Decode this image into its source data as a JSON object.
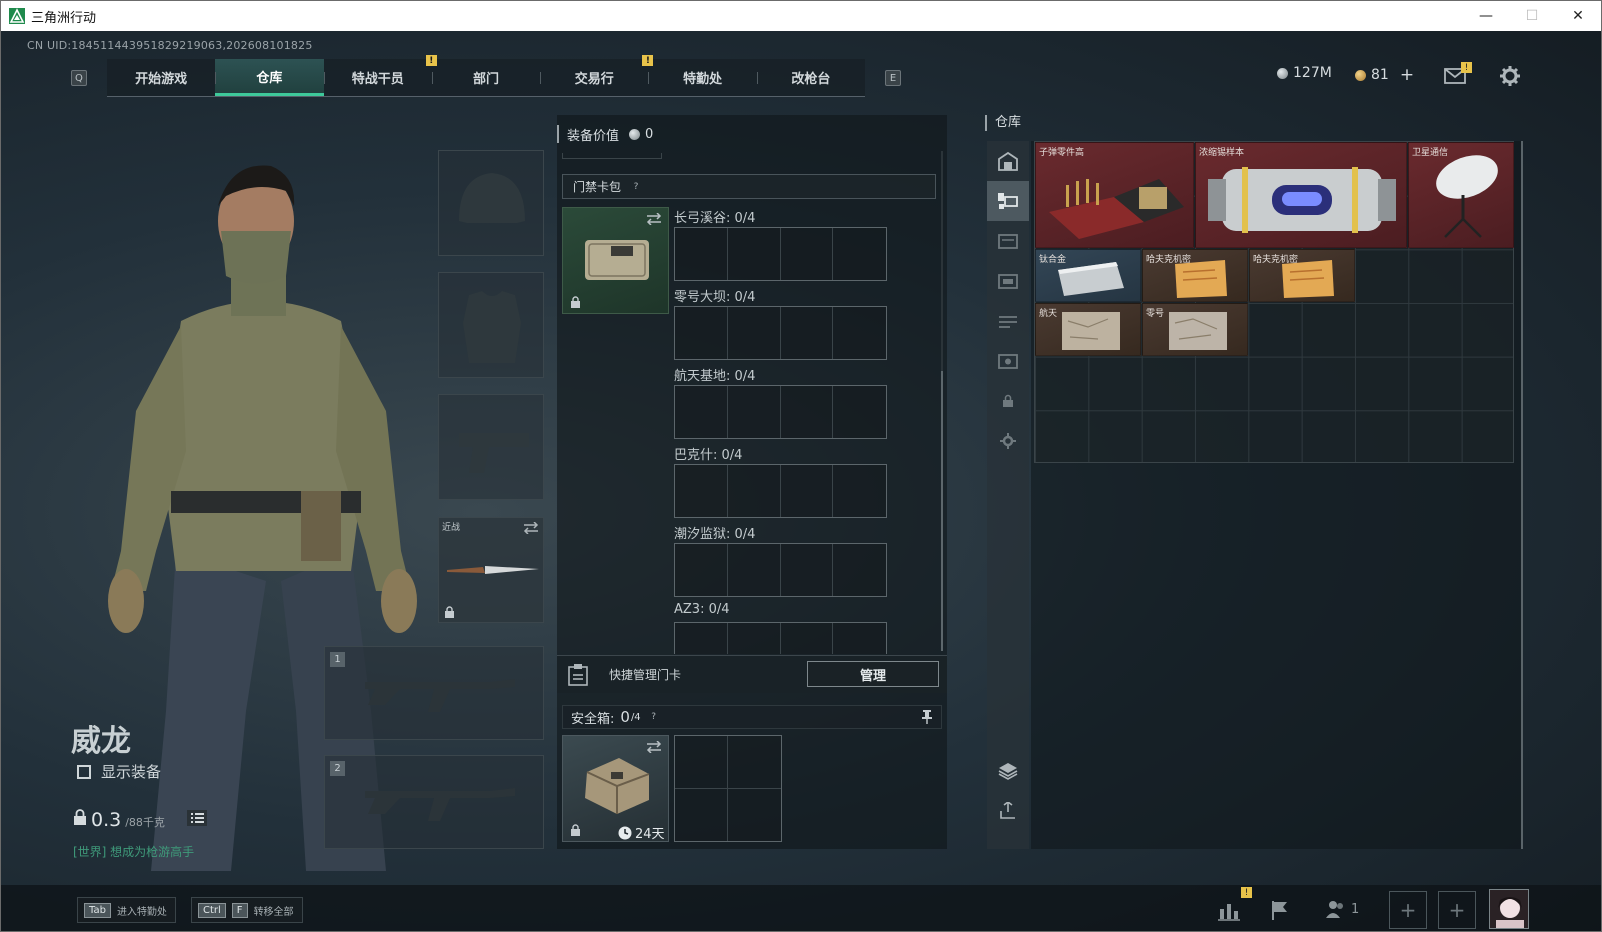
{
  "window": {
    "title": "三角洲行动"
  },
  "uid": "CN UID:1845114439518292190​63,202608101825",
  "nav": {
    "left_key": "Q",
    "right_key": "E",
    "tabs": [
      {
        "label": "开始游戏",
        "active": false,
        "badge": ""
      },
      {
        "label": "仓库",
        "active": true,
        "badge": ""
      },
      {
        "label": "特战干员",
        "active": false,
        "badge": ""
      },
      {
        "label": "部门",
        "active": false,
        "badge": "!"
      },
      {
        "label": "交易行",
        "active": false,
        "badge": ""
      },
      {
        "label": "特勤处",
        "active": false,
        "badge": "!"
      },
      {
        "label": "改枪台",
        "active": false,
        "badge": ""
      }
    ]
  },
  "currency": {
    "havoc_coins": "127M",
    "tickets": "81",
    "tickets_add": "+",
    "mail_badge": "!"
  },
  "character": {
    "name": "威龙",
    "show_gear_label": "显示装备",
    "weight_current": "0.3",
    "weight_max": "/88千克",
    "world_chat": "[世界] 想成为枪游高手",
    "melee_label": "近战"
  },
  "equipment": {
    "slot_numbers": [
      "1",
      "2"
    ]
  },
  "middle": {
    "value_label": "装备价值",
    "value": "0",
    "keycard_section": "门禁卡包",
    "keycard_help": "?",
    "keycards": [
      {
        "label": "长弓溪谷: 0/4"
      },
      {
        "label": "零号大坝: 0/4"
      },
      {
        "label": "航天基地: 0/4"
      },
      {
        "label": "巴克什: 0/4"
      },
      {
        "label": "潮汐监狱: 0/4"
      },
      {
        "label": "AZ3: 0/4"
      }
    ],
    "quick_manage_label": "快捷管理门卡",
    "manage_button": "管理",
    "safe_label": "安全箱:",
    "safe_count": "0",
    "safe_capacity": "/4",
    "safe_help": "?",
    "safe_days": "24天"
  },
  "warehouse": {
    "title": "仓库",
    "items": [
      {
        "name": "子弹零件高",
        "color": "red"
      },
      {
        "name": "浓缩锡样本",
        "color": "red"
      },
      {
        "name": "卫星通信",
        "color": "red"
      },
      {
        "name": "钛合金",
        "color": "blue"
      },
      {
        "name": "哈夫克机密",
        "color": "brown"
      },
      {
        "name": "哈夫克机密",
        "color": "brown"
      },
      {
        "name": "航天",
        "color": "brown"
      },
      {
        "name": "零号",
        "color": "brown"
      }
    ]
  },
  "bottom": {
    "hint1_key": "Tab",
    "hint1_label": "进入特勤处",
    "hint2_key1": "Ctrl",
    "hint2_key2": "F",
    "hint2_label": "转移全部",
    "friends_count": "1",
    "stats_badge": "!"
  }
}
